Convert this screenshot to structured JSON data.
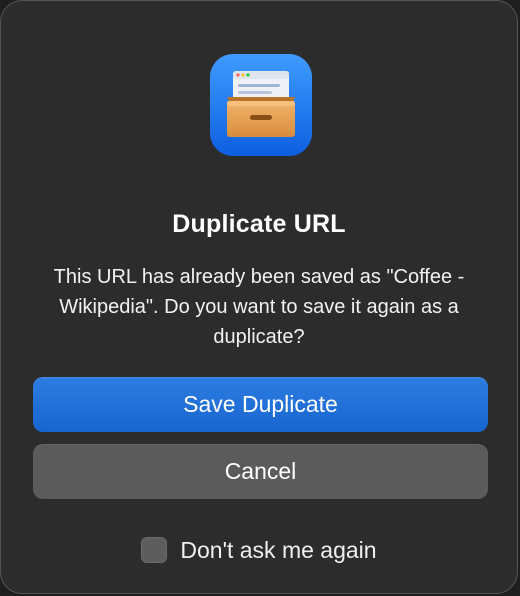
{
  "dialog": {
    "app_icon": "file-box-app-icon",
    "title": "Duplicate URL",
    "message": "This URL has already been saved as \"Coffee - Wikipedia\". Do you want to save it again as a duplicate?",
    "primary_button_label": "Save Duplicate",
    "secondary_button_label": "Cancel",
    "checkbox_label": "Don't ask me again",
    "checkbox_checked": false
  },
  "colors": {
    "dialog_bg": "#2c2c2c",
    "primary_button": "#1f6fd9",
    "secondary_button": "#5b5b5b",
    "text": "#ffffff"
  }
}
